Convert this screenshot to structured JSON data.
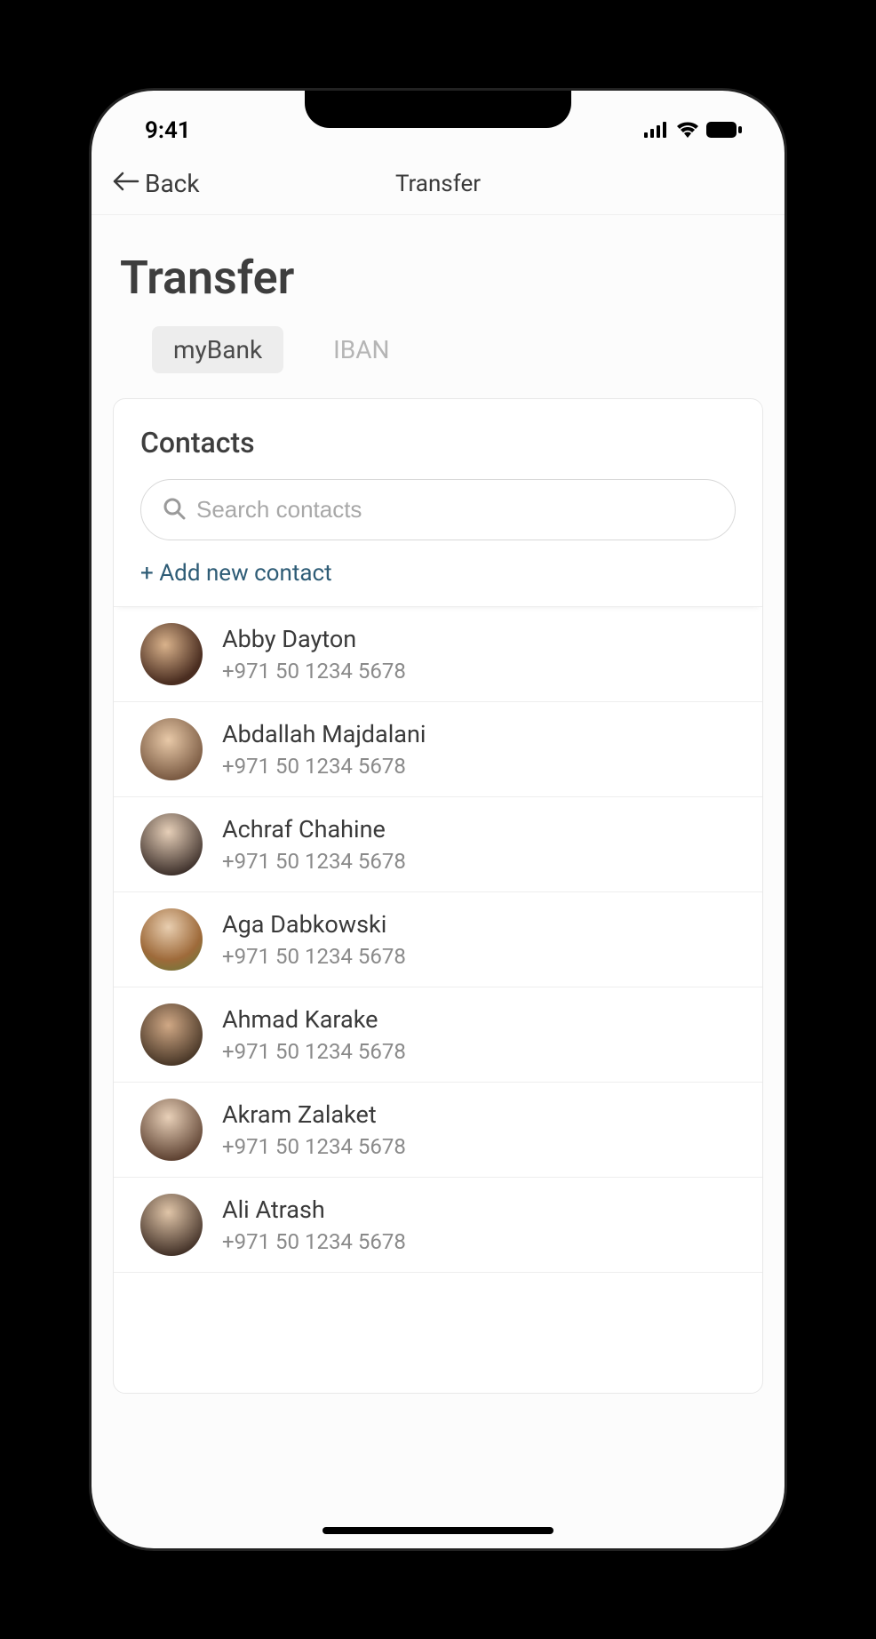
{
  "status": {
    "time": "9:41"
  },
  "nav": {
    "back": "Back",
    "title": "Transfer"
  },
  "page": {
    "title": "Transfer"
  },
  "tabs": [
    {
      "label": "myBank",
      "active": true
    },
    {
      "label": "IBAN",
      "active": false
    }
  ],
  "contacts_panel": {
    "title": "Contacts",
    "search_placeholder": "Search contacts",
    "add_label": "+ Add new contact"
  },
  "contacts": [
    {
      "name": "Abby Dayton",
      "phone": "+971 50 1234 5678"
    },
    {
      "name": "Abdallah Majdalani",
      "phone": "+971 50 1234 5678"
    },
    {
      "name": "Achraf Chahine",
      "phone": "+971 50 1234 5678"
    },
    {
      "name": "Aga Dabkowski",
      "phone": "+971 50 1234 5678"
    },
    {
      "name": "Ahmad Karake",
      "phone": "+971 50 1234 5678"
    },
    {
      "name": "Akram Zalaket",
      "phone": "+971 50 1234 5678"
    },
    {
      "name": "Ali Atrash",
      "phone": "+971 50 1234 5678"
    }
  ]
}
